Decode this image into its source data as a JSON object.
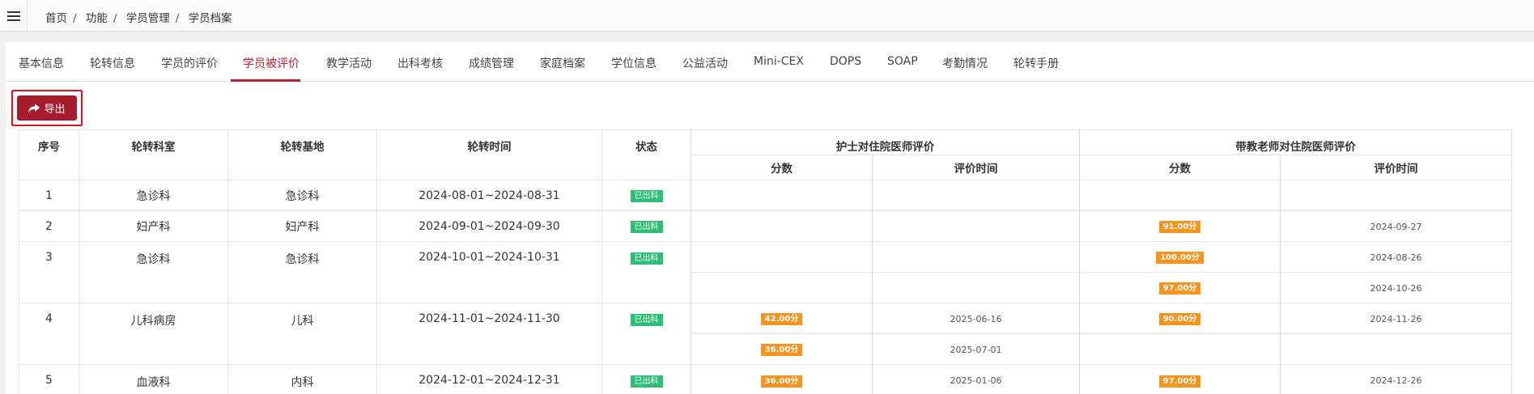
{
  "breadcrumb": [
    "首页",
    "功能",
    "学员管理",
    "学员档案"
  ],
  "tabs": [
    "基本信息",
    "轮转信息",
    "学员的评价",
    "学员被评价",
    "教学活动",
    "出科考核",
    "成绩管理",
    "家庭档案",
    "学位信息",
    "公益活动",
    "Mini-CEX",
    "DOPS",
    "SOAP",
    "考勤情况",
    "轮转手册"
  ],
  "active_tab": "学员被评价",
  "export_label": "导出",
  "table": {
    "headers": {
      "seq": "序号",
      "dept": "轮转科室",
      "base": "轮转基地",
      "time": "轮转时间",
      "status": "状态",
      "nurse_group": "护士对住院医师评价",
      "teacher_group": "带教老师对住院医师评价",
      "score": "分数",
      "eval_time": "评价时间"
    },
    "rows": [
      {
        "seq": "1",
        "dept": "急诊科",
        "base": "急诊科",
        "time": "2024-08-01~2024-08-31",
        "status": "已出科"
      },
      {
        "seq": "2",
        "dept": "妇产科",
        "base": "妇产科",
        "time": "2024-09-01~2024-09-30",
        "status": "已出科"
      },
      {
        "seq": "3",
        "dept": "急诊科",
        "base": "急诊科",
        "time": "2024-10-01~2024-10-31",
        "status": "已出科"
      },
      {
        "seq": "4",
        "dept": "儿科病房",
        "base": "儿科",
        "time": "2024-11-01~2024-11-30",
        "status": "已出科"
      },
      {
        "seq": "5",
        "dept": "血液科",
        "base": "内科",
        "time": "2024-12-01~2024-12-31",
        "status": "已出科"
      }
    ],
    "scores": {
      "r2_t1": {
        "score": "91.00分",
        "date": "2024-09-27"
      },
      "r3_t1": {
        "score": "100.00分",
        "date": "2024-08-26"
      },
      "r3_t2": {
        "score": "97.00分",
        "date": "2024-10-26"
      },
      "r4_n1": {
        "score": "42.00分",
        "date": "2025-06-16"
      },
      "r4_n2": {
        "score": "36.00分",
        "date": "2025-07-01"
      },
      "r4_t1": {
        "score": "90.00分",
        "date": "2024-11-26"
      },
      "r5_n1": {
        "score": "36.00分",
        "date": "2025-01-06"
      },
      "r5_t1": {
        "score": "97.00分",
        "date": "2024-12-26"
      }
    }
  },
  "colors": {
    "accent": "#b7202e",
    "button": "#a51d2c",
    "status_green": "#2bbf76",
    "score_orange": "#f7941d"
  }
}
